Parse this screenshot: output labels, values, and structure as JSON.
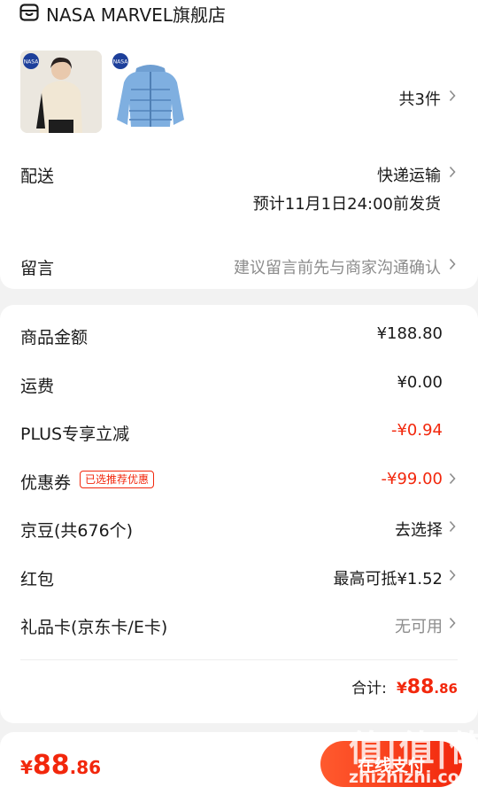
{
  "store": {
    "name": "NASA MARVEL旗舰店",
    "icon": "store-icon"
  },
  "products": {
    "count_label": "共3件"
  },
  "delivery": {
    "label": "配送",
    "method": "快递运输",
    "estimate": "预计11月1日24:00前发货"
  },
  "message": {
    "label": "留言",
    "placeholder": "建议留言前先与商家沟通确认"
  },
  "pricing": {
    "goods_label": "商品金额",
    "goods_value": "¥188.80",
    "shipping_label": "运费",
    "shipping_value": "¥0.00",
    "plus_label": "PLUS专享立减",
    "plus_value": "-¥0.94",
    "coupon_label": "优惠券",
    "coupon_tag": "已选推荐优惠",
    "coupon_value": "-¥99.00",
    "jd_bean_label": "京豆(共676个)",
    "jd_bean_value": "去选择",
    "red_packet_label": "红包",
    "red_packet_value": "最高可抵¥1.52",
    "gift_card_label": "礼品卡(京东卡/E卡)",
    "gift_card_value": "无可用",
    "total_label": "合计:",
    "total_currency": "¥",
    "total_int": "88",
    "total_dec": ".86"
  },
  "bottom": {
    "currency": "¥",
    "amount_int": "88",
    "amount_dec": ".86",
    "pay_label": "在线支付"
  },
  "watermark": {
    "line1": "值|值|值",
    "line2": "zhizhizhi.com"
  },
  "colors": {
    "accent": "#f2270c",
    "muted": "#8c8c8c",
    "background": "#f2f2f2"
  }
}
